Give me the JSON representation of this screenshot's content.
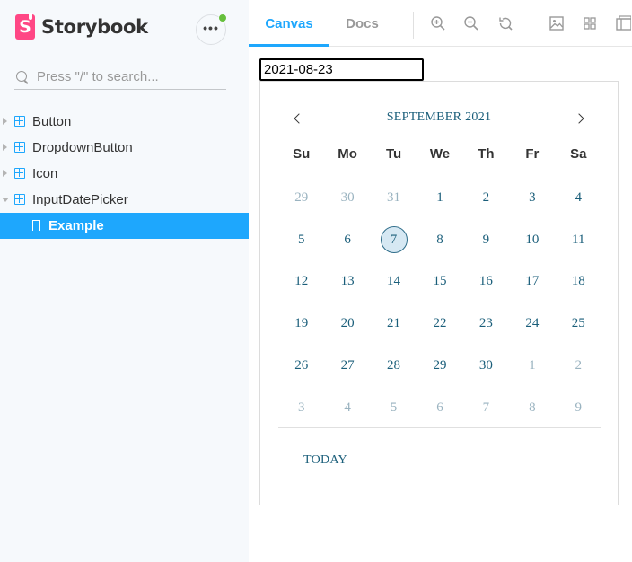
{
  "sidebar": {
    "brand": {
      "name": "Storybook",
      "logo_letter": "S"
    },
    "menu": {
      "label": "•••"
    },
    "search": {
      "placeholder": "Press \"/\" to search..."
    },
    "items": [
      {
        "label": "Button"
      },
      {
        "label": "DropdownButton"
      },
      {
        "label": "Icon"
      },
      {
        "label": "InputDatePicker"
      },
      {
        "label": "Example"
      }
    ]
  },
  "toolbar": {
    "tabs": [
      {
        "label": "Canvas"
      },
      {
        "label": "Docs"
      }
    ],
    "tools": [
      "zoom-in-icon",
      "zoom-out-icon",
      "zoom-reset-icon",
      "background-icon",
      "grid-icon",
      "viewport-icon"
    ]
  },
  "datepicker": {
    "input_value": "2021-08-23",
    "month_label": "SEPTEMBER 2021",
    "weekdays": [
      "Su",
      "Mo",
      "Tu",
      "We",
      "Th",
      "Fr",
      "Sa"
    ],
    "weeks": [
      [
        "29",
        "30",
        "31",
        "1",
        "2",
        "3",
        "4"
      ],
      [
        "5",
        "6",
        "7",
        "8",
        "9",
        "10",
        "11"
      ],
      [
        "12",
        "13",
        "14",
        "15",
        "16",
        "17",
        "18"
      ],
      [
        "19",
        "20",
        "21",
        "22",
        "23",
        "24",
        "25"
      ],
      [
        "26",
        "27",
        "28",
        "29",
        "30",
        "1",
        "2"
      ],
      [
        "3",
        "4",
        "5",
        "6",
        "7",
        "8",
        "9"
      ]
    ],
    "selected_day": "7",
    "today_label": "TODAY"
  },
  "colors": {
    "accent": "#1ea7fd",
    "brand_pink": "#ff4785",
    "calendar_text": "#1a5e7a",
    "notify_dot": "#66bf3c"
  }
}
